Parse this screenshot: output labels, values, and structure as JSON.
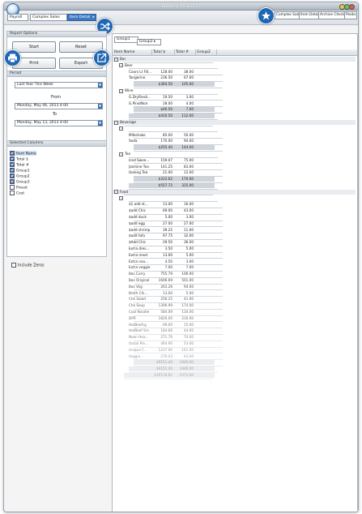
{
  "window": {
    "title": "Weekly Logistics"
  },
  "toolbar": {
    "tabs": [
      {
        "label": "Payroll",
        "active": false
      },
      {
        "label": "Complex Sales",
        "active": false
      },
      {
        "label": "Item Detail",
        "active": true
      }
    ],
    "more_arrow": "▸",
    "report_tabs": [
      "Complex Sales",
      "Item Detail",
      "Archive Checks",
      "Peaks"
    ]
  },
  "report_options": {
    "header": "Report Options",
    "buttons": {
      "start": "Start",
      "reset": "Reset",
      "print": "Print",
      "export": "Export"
    }
  },
  "period": {
    "header": "Period",
    "preset": "Last Year This Week",
    "from_label": "From",
    "from_value": "Monday, May 06, 2013 4:00",
    "to_label": "To",
    "to_value": "Monday, May 13, 2013 4:00"
  },
  "selected_columns": {
    "header": "Selected Columns",
    "items": [
      {
        "label": "Item Name",
        "checked": true
      },
      {
        "label": "Total $",
        "checked": true
      },
      {
        "label": "Total #",
        "checked": true
      },
      {
        "label": "Group1",
        "checked": true
      },
      {
        "label": "Group2",
        "checked": true
      },
      {
        "label": "Group3",
        "checked": true
      },
      {
        "label": "Preset",
        "checked": false
      },
      {
        "label": "Cost",
        "checked": false
      }
    ],
    "include_zeros": "Include Zeros"
  },
  "grid": {
    "group_boxes": [
      "Group1",
      "Group2"
    ],
    "columns": [
      "Item Name",
      "Total $",
      "Total #",
      "Group2"
    ],
    "rows": [
      {
        "kind": "group",
        "indent": 0,
        "name": "Bar"
      },
      {
        "kind": "group",
        "indent": 1,
        "name": "Beer"
      },
      {
        "kind": "item",
        "indent": 2,
        "name": "Coors Lt Fill...",
        "total": "128.00",
        "count": "38.00"
      },
      {
        "kind": "item",
        "indent": 2,
        "name": "Tangerine",
        "total": "236.50",
        "count": "67.00"
      },
      {
        "kind": "subtotal",
        "indent": 2,
        "name": "",
        "total": "$364.50",
        "count": "105.00"
      },
      {
        "kind": "group",
        "indent": 1,
        "name": "Wine"
      },
      {
        "kind": "item",
        "indent": 2,
        "name": "G.DryRiesli...",
        "total": "19.50",
        "count": "3.00"
      },
      {
        "kind": "item",
        "indent": 2,
        "name": "G.PinotNoir",
        "total": "28.00",
        "count": "4.00"
      },
      {
        "kind": "subtotal",
        "indent": 2,
        "name": "",
        "total": "$46.50",
        "count": "7.00"
      },
      {
        "kind": "subtotal",
        "indent": 1,
        "name": "",
        "total": "$410.50",
        "count": "112.00"
      },
      {
        "kind": "group",
        "indent": 0,
        "name": "Beverage"
      },
      {
        "kind": "group",
        "indent": 1,
        "name": ""
      },
      {
        "kind": "item",
        "indent": 2,
        "name": "Milkshake",
        "total": "85.00",
        "count": "50.00"
      },
      {
        "kind": "item",
        "indent": 2,
        "name": "Soda",
        "total": "170.00",
        "count": "94.00"
      },
      {
        "kind": "subtotal",
        "indent": 2,
        "name": "",
        "total": "$255.40",
        "count": "144.00"
      },
      {
        "kind": "group",
        "indent": 1,
        "name": "Tea"
      },
      {
        "kind": "item",
        "indent": 2,
        "name": "Iced Swee...",
        "total": "159.07",
        "count": "75.00"
      },
      {
        "kind": "item",
        "indent": 2,
        "name": "Jasmine Tea",
        "total": "141.25",
        "count": "83.00"
      },
      {
        "kind": "item",
        "indent": 2,
        "name": "Oolong Tea",
        "total": "21.00",
        "count": "12.00"
      },
      {
        "kind": "subtotal",
        "indent": 2,
        "name": "",
        "total": "$312.62",
        "count": "170.00"
      },
      {
        "kind": "subtotal",
        "indent": 1,
        "name": "",
        "total": "$557.72",
        "count": "315.00"
      },
      {
        "kind": "group",
        "indent": 0,
        "name": "Food"
      },
      {
        "kind": "group",
        "indent": 1,
        "name": ""
      },
      {
        "kind": "item",
        "indent": 2,
        "name": "$1 add st...",
        "total": "13.00",
        "count": "16.00"
      },
      {
        "kind": "item",
        "indent": 2,
        "name": "$add Chic",
        "total": "69.00",
        "count": "43.00"
      },
      {
        "kind": "item",
        "indent": 2,
        "name": "$add duck",
        "total": "5.00",
        "count": "3.00"
      },
      {
        "kind": "item",
        "indent": 2,
        "name": "$add egg",
        "total": "27.00",
        "count": "27.00"
      },
      {
        "kind": "item",
        "indent": 2,
        "name": "$add shrimp",
        "total": "39.25",
        "count": "11.00"
      },
      {
        "kind": "item",
        "indent": 2,
        "name": "$add tofu",
        "total": "97.75",
        "count": "32.00"
      },
      {
        "kind": "item",
        "indent": 2,
        "name": "$Add Chic",
        "total": "29.50",
        "count": "36.00"
      },
      {
        "kind": "item",
        "indent": 2,
        "name": "Extra dres...",
        "total": "3.50",
        "count": "5.00"
      },
      {
        "kind": "item",
        "indent": 2,
        "name": "Extra meat",
        "total": "13.00",
        "count": "5.00"
      },
      {
        "kind": "item",
        "indent": 2,
        "name": "Extra noo...",
        "total": "4.50",
        "count": "3.00"
      },
      {
        "kind": "item",
        "indent": 2,
        "name": "Extra veggie",
        "total": "7.00",
        "count": "7.00"
      },
      {
        "kind": "item",
        "indent": 2,
        "name": "Bas Curry",
        "total": "755.79",
        "count": "106.00"
      },
      {
        "kind": "item",
        "indent": 2,
        "name": "Bas Original",
        "total": "1606.69",
        "count": "501.00"
      },
      {
        "kind": "item",
        "indent": 2,
        "name": "Bas Veg",
        "total": "263.26",
        "count": "94.00"
      },
      {
        "kind": "item",
        "indent": 2,
        "name": "Broth Chi...",
        "total": "13.00",
        "count": "5.00"
      },
      {
        "kind": "item",
        "indent": 2,
        "name": "Chk Salad",
        "total": "256.25",
        "count": "41.00"
      },
      {
        "kind": "item",
        "indent": 2,
        "name": "Chk Soup",
        "total": "1306.99",
        "count": "174.00"
      },
      {
        "kind": "item",
        "indent": 2,
        "name": "Cool Noodle",
        "total": "584.09",
        "count": "134.00"
      },
      {
        "kind": "item",
        "indent": 2,
        "name": "DPR",
        "total": "1826.00",
        "count": "216.00"
      },
      {
        "kind": "item",
        "indent": 2,
        "name": "HotBeefLg",
        "total": "69.00",
        "count": "15.00"
      },
      {
        "kind": "item",
        "indent": 2,
        "name": "HotBeef Sm",
        "total": "184.66",
        "count": "44.00"
      },
      {
        "kind": "item",
        "indent": 2,
        "name": "Noon Hea...",
        "total": "271.76",
        "count": "74.00"
      },
      {
        "kind": "item",
        "indent": 2,
        "name": "Oxtail Pie...",
        "total": "464.90",
        "count": "53.00"
      },
      {
        "kind": "item",
        "indent": 2,
        "name": "Unique F...",
        "total": "1237.90",
        "count": "161.00"
      },
      {
        "kind": "item",
        "indent": 2,
        "name": "Veggie...",
        "total": "276.03",
        "count": "63.00"
      },
      {
        "kind": "subtotal",
        "indent": 2,
        "name": "",
        "total": "$9151.40",
        "count": "1946.00"
      },
      {
        "kind": "subtotal",
        "indent": 1,
        "name": "",
        "total": "$9151.40",
        "count": "1946.00"
      },
      {
        "kind": "subtotal",
        "indent": 0,
        "name": "",
        "total": "$10119.62",
        "count": "2373.00"
      }
    ]
  }
}
